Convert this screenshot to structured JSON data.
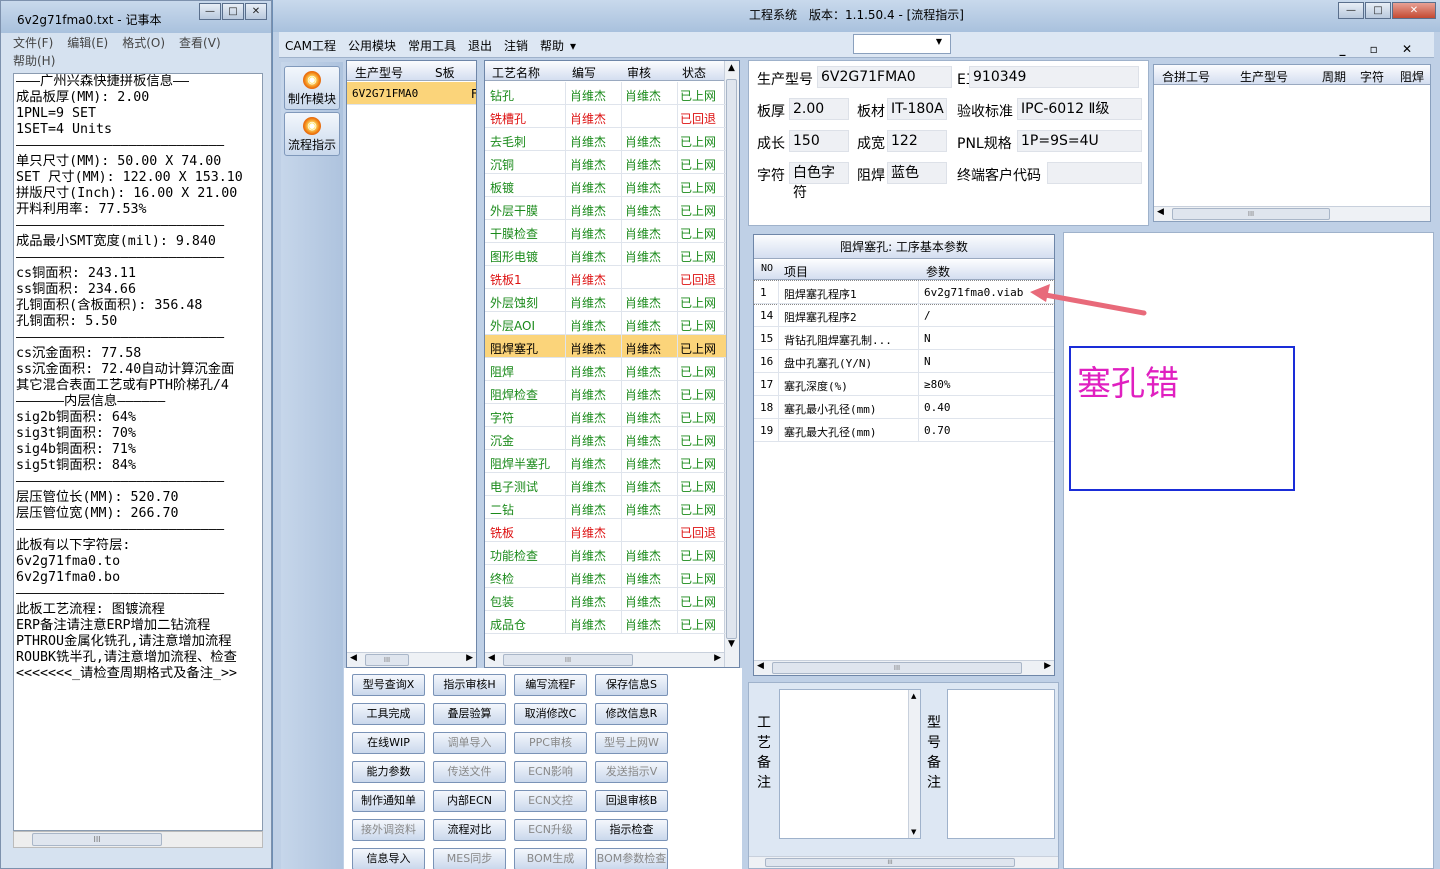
{
  "notepad": {
    "title": "6v2g71fma0.txt - 记事本",
    "menu": [
      "文件(F)",
      "编辑(E)",
      "格式(O)",
      "查看(V)",
      "帮助(H)"
    ],
    "lines": [
      "———广州兴森快捷拼板信息——",
      "成品板厚(MM): 2.00",
      "1PNL=9 SET",
      "1SET=4 Units",
      "——————————————————————————",
      "单只尺寸(MM): 50.00 X 74.00",
      "SET 尺寸(MM): 122.00 X 153.10",
      "拼版尺寸(Inch): 16.00 X 21.00",
      "开料利用率: 77.53%",
      "——————————————————————————",
      "成品最小SMT宽度(mil): 9.840",
      "——————————————————————————",
      "cs铜面积: 243.11",
      "ss铜面积: 234.66",
      "孔铜面积(含板面积): 356.48",
      "孔铜面积: 5.50",
      "——————————————————————————",
      "cs沉金面积: 77.58",
      "ss沉金面积: 72.40自动计算沉金面",
      "其它混合表面工艺或有PTH阶梯孔/4",
      "——————内层信息——————",
      "sig2b铜面积: 64%",
      "sig3t铜面积: 70%",
      "sig4b铜面积: 71%",
      "sig5t铜面积: 84%",
      "——————————————————————————",
      "层压管位长(MM): 520.70",
      "层压管位宽(MM): 266.70",
      "——————————————————————————",
      "此板有以下字符层:",
      "6v2g71fma0.to",
      "6v2g71fma0.bo",
      "——————————————————————————",
      "此板工艺流程: 图镀流程",
      "ERP备注请注意ERP增加二钻流程",
      "PTHROU金属化铣孔,请注意增加流程",
      "ROUBK铣半孔,请注意增加流程、检查",
      "<<<<<<<_请检查周期格式及备注_>>"
    ],
    "hscroll": "III"
  },
  "app": {
    "title": "工程系统　版本：1.1.50.4 - [流程指示]",
    "window_controls": [
      "—",
      "□",
      "✕"
    ],
    "menu": [
      "CAM工程",
      "公用模块",
      "常用工具",
      "退出",
      "注销",
      "帮助",
      "▾"
    ],
    "mdi_controls": "_ ▫ ✕",
    "toolbar": [
      "制作模块",
      "流程指示"
    ],
    "model_grid": {
      "headers": [
        "生产型号",
        "S板",
        ""
      ],
      "rows": [
        {
          "model": "6V2G71FMA0",
          "s": "F"
        }
      ],
      "hscroll": "III"
    },
    "process_grid": {
      "headers": [
        "工艺名称",
        "编写",
        "审核",
        "状态"
      ],
      "rows": [
        {
          "name": "钻孔",
          "w": "肖维杰",
          "a": "肖维杰",
          "s": "已上网",
          "st": "g"
        },
        {
          "name": "铣槽孔",
          "w": "肖维杰",
          "a": "",
          "s": "已回退",
          "st": "r"
        },
        {
          "name": "去毛刺",
          "w": "肖维杰",
          "a": "肖维杰",
          "s": "已上网",
          "st": "g"
        },
        {
          "name": "沉铜",
          "w": "肖维杰",
          "a": "肖维杰",
          "s": "已上网",
          "st": "g"
        },
        {
          "name": "板镀",
          "w": "肖维杰",
          "a": "肖维杰",
          "s": "已上网",
          "st": "g"
        },
        {
          "name": "外层干膜",
          "w": "肖维杰",
          "a": "肖维杰",
          "s": "已上网",
          "st": "g"
        },
        {
          "name": "干膜检查",
          "w": "肖维杰",
          "a": "肖维杰",
          "s": "已上网",
          "st": "g"
        },
        {
          "name": "图形电镀",
          "w": "肖维杰",
          "a": "肖维杰",
          "s": "已上网",
          "st": "g"
        },
        {
          "name": "铣板1",
          "w": "肖维杰",
          "a": "",
          "s": "已回退",
          "st": "r"
        },
        {
          "name": "外层蚀刻",
          "w": "肖维杰",
          "a": "肖维杰",
          "s": "已上网",
          "st": "g"
        },
        {
          "name": "外层AOI",
          "w": "肖维杰",
          "a": "肖维杰",
          "s": "已上网",
          "st": "g"
        },
        {
          "name": "阻焊塞孔",
          "w": "肖维杰",
          "a": "肖维杰",
          "s": "已上网",
          "st": "sel"
        },
        {
          "name": "阻焊",
          "w": "肖维杰",
          "a": "肖维杰",
          "s": "已上网",
          "st": "g"
        },
        {
          "name": "阻焊检查",
          "w": "肖维杰",
          "a": "肖维杰",
          "s": "已上网",
          "st": "g"
        },
        {
          "name": "字符",
          "w": "肖维杰",
          "a": "肖维杰",
          "s": "已上网",
          "st": "g"
        },
        {
          "name": "沉金",
          "w": "肖维杰",
          "a": "肖维杰",
          "s": "已上网",
          "st": "g"
        },
        {
          "name": "阻焊半塞孔",
          "w": "肖维杰",
          "a": "肖维杰",
          "s": "已上网",
          "st": "g"
        },
        {
          "name": "电子测试",
          "w": "肖维杰",
          "a": "肖维杰",
          "s": "已上网",
          "st": "g"
        },
        {
          "name": "二钻",
          "w": "肖维杰",
          "a": "肖维杰",
          "s": "已上网",
          "st": "g"
        },
        {
          "name": "铣板",
          "w": "肖维杰",
          "a": "",
          "s": "已回退",
          "st": "r"
        },
        {
          "name": "功能检查",
          "w": "肖维杰",
          "a": "肖维杰",
          "s": "已上网",
          "st": "g"
        },
        {
          "name": "终检",
          "w": "肖维杰",
          "a": "肖维杰",
          "s": "已上网",
          "st": "g"
        },
        {
          "name": "包装",
          "w": "肖维杰",
          "a": "肖维杰",
          "s": "已上网",
          "st": "g"
        },
        {
          "name": "成品仓",
          "w": "肖维杰",
          "a": "肖维杰",
          "s": "已上网",
          "st": "g"
        }
      ],
      "hscroll": "III"
    },
    "buttons": [
      [
        {
          "t": "型号查询X",
          "d": false
        },
        {
          "t": "指示审核H",
          "d": false
        },
        {
          "t": "编写流程F",
          "d": false
        },
        {
          "t": "保存信息S",
          "d": false
        }
      ],
      [
        {
          "t": "工具完成",
          "d": false
        },
        {
          "t": "叠层验算",
          "d": false
        },
        {
          "t": "取消修改C",
          "d": false
        },
        {
          "t": "修改信息R",
          "d": false
        }
      ],
      [
        {
          "t": "在线WIP",
          "d": false
        },
        {
          "t": "调单导入",
          "d": true
        },
        {
          "t": "PPC审核",
          "d": true
        },
        {
          "t": "型号上网W",
          "d": true
        }
      ],
      [
        {
          "t": "能力参数",
          "d": false
        },
        {
          "t": "传送文件",
          "d": true
        },
        {
          "t": "ECN影响",
          "d": true
        },
        {
          "t": "发送指示V",
          "d": true
        }
      ],
      [
        {
          "t": "制作通知单",
          "d": false
        },
        {
          "t": "内部ECN",
          "d": false
        },
        {
          "t": "ECN文控",
          "d": true
        },
        {
          "t": "回退审核B",
          "d": false
        }
      ],
      [
        {
          "t": "接外调资料",
          "d": true
        },
        {
          "t": "流程对比",
          "d": false
        },
        {
          "t": "ECN升级",
          "d": true
        },
        {
          "t": "指示检查",
          "d": false
        }
      ],
      [
        {
          "t": "信息导入",
          "d": false
        },
        {
          "t": "MES同步",
          "d": true
        },
        {
          "t": "BOM生成",
          "d": true
        },
        {
          "t": "BOM参数检查",
          "d": true
        }
      ]
    ],
    "info": {
      "r1": [
        {
          "l": "生产型号",
          "v": "6V2G71FMA0"
        },
        {
          "l": "E工号",
          "v": "910349"
        }
      ],
      "r2": [
        {
          "l": "板厚",
          "v": "2.00"
        },
        {
          "l": "板材",
          "v": "IT-180A"
        },
        {
          "l": "验收标准",
          "v": "IPC-6012 Ⅱ级"
        }
      ],
      "r3": [
        {
          "l": "成长",
          "v": "150"
        },
        {
          "l": "成宽",
          "v": "122"
        },
        {
          "l": "PNL规格",
          "v": "1P=9S=4U"
        }
      ],
      "r4": [
        {
          "l": "字符",
          "v": "白色字符"
        },
        {
          "l": "阻焊",
          "v": "蓝色"
        },
        {
          "l": "终端客户代码",
          "v": ""
        }
      ]
    },
    "merge_grid": {
      "headers": [
        "合拼工号",
        "生产型号",
        "周期",
        "字符",
        "阻焊"
      ],
      "hscroll": "III"
    },
    "param_grid": {
      "title": "阻焊塞孔: 工序基本参数",
      "headers": [
        "NO",
        "项目",
        "参数"
      ],
      "rows": [
        {
          "no": "1",
          "item": "阻焊塞孔程序1",
          "val": "6v2g71fma0.viab"
        },
        {
          "no": "14",
          "item": "阻焊塞孔程序2",
          "val": "/"
        },
        {
          "no": "15",
          "item": "背钻孔阻焊塞孔制...",
          "val": "N"
        },
        {
          "no": "16",
          "item": "盘中孔塞孔(Y/N)",
          "val": "N"
        },
        {
          "no": "17",
          "item": "塞孔深度(%)",
          "val": "≥80%"
        },
        {
          "no": "18",
          "item": "塞孔最小孔径(mm)",
          "val": "0.40"
        },
        {
          "no": "19",
          "item": "塞孔最大孔径(mm)",
          "val": "0.70"
        }
      ],
      "hscroll": "III"
    },
    "annotation": {
      "text": "塞孔错",
      "arrow_color": "#e86a7a",
      "box_color": "#1a2dd8",
      "text_color": "#e020c0"
    },
    "notes": {
      "process_label": [
        "工",
        "艺",
        "备",
        "注"
      ],
      "model_label": [
        "型",
        "号",
        "备",
        "注"
      ],
      "hscroll": "III"
    }
  }
}
